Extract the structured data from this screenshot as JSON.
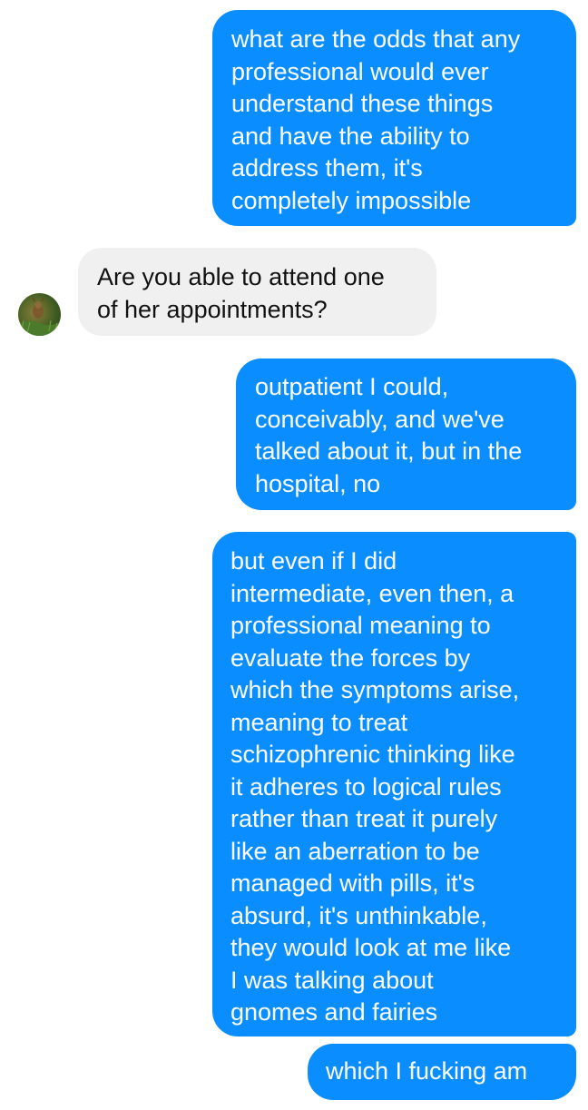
{
  "conversation": {
    "messages": [
      {
        "direction": "outgoing",
        "text": "what are the odds that any\nprofessional would ever\nunderstand these things\nand have the ability to\naddress them, it's\ncompletely impossible"
      },
      {
        "direction": "incoming",
        "text": "Are you able to attend one\nof her appointments?"
      },
      {
        "direction": "outgoing",
        "text": "outpatient I could,\nconceivably, and we've\ntalked about it, but in the\nhospital, no"
      },
      {
        "direction": "outgoing",
        "text": "but even if I did\nintermediate, even then, a\nprofessional meaning to\nevaluate the forces by\nwhich the symptoms arise,\nmeaning to treat\nschizophrenic thinking like\nit adheres to logical rules\nrather than treat it purely\nlike an aberration to be\nmanaged with pills, it's\nabsurd, it's unthinkable,\nthey would look at me like\nI was talking about\ngnomes and fairies"
      },
      {
        "direction": "outgoing",
        "text": "which I fucking am"
      }
    ],
    "contact_avatar_icon": "contact-photo-icon"
  },
  "colors": {
    "outgoing_bubble": "#0a8eff",
    "incoming_bubble": "#f0f0f0",
    "background": "#ffffff"
  }
}
